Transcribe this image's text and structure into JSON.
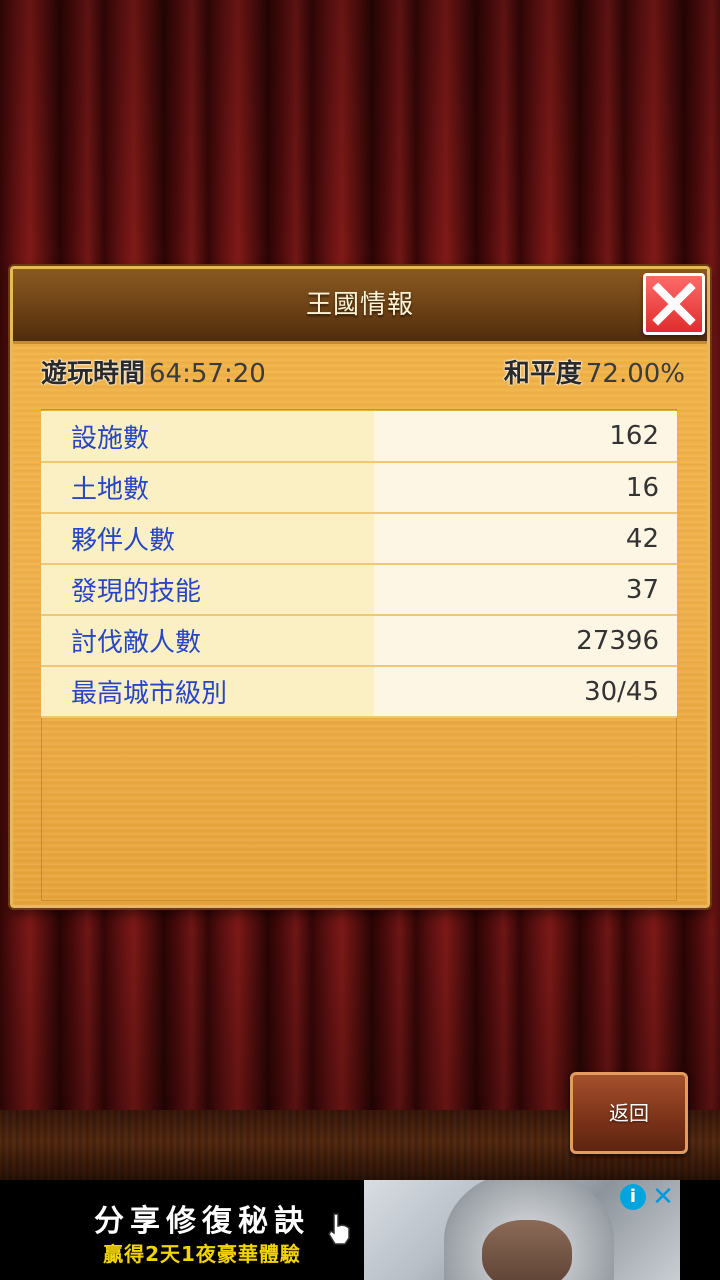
{
  "panel": {
    "title": "王國情報",
    "close_icon": "close-icon",
    "summary": {
      "play_time_label": "遊玩時間",
      "play_time_value": "64:57:20",
      "peace_label": "和平度",
      "peace_value": "72.00%"
    },
    "stats": [
      {
        "label": "設施數",
        "value": "162"
      },
      {
        "label": "土地數",
        "value": "16"
      },
      {
        "label": "夥伴人數",
        "value": "42"
      },
      {
        "label": "發現的技能",
        "value": "37"
      },
      {
        "label": "討伐敵人數",
        "value": "27396"
      },
      {
        "label": "最高城市級別",
        "value": "30/45"
      }
    ]
  },
  "back_button": {
    "label": "返回"
  },
  "ad": {
    "line1": "分享修復秘訣",
    "line2": "贏得2天1夜豪華體驗",
    "info_icon": "info-icon",
    "close_icon": "close-icon"
  },
  "colors": {
    "panel_wood": "#f0b04a",
    "label_blue": "#2746c6",
    "close_red": "#e02c2c",
    "curtain": "#6e1414"
  }
}
